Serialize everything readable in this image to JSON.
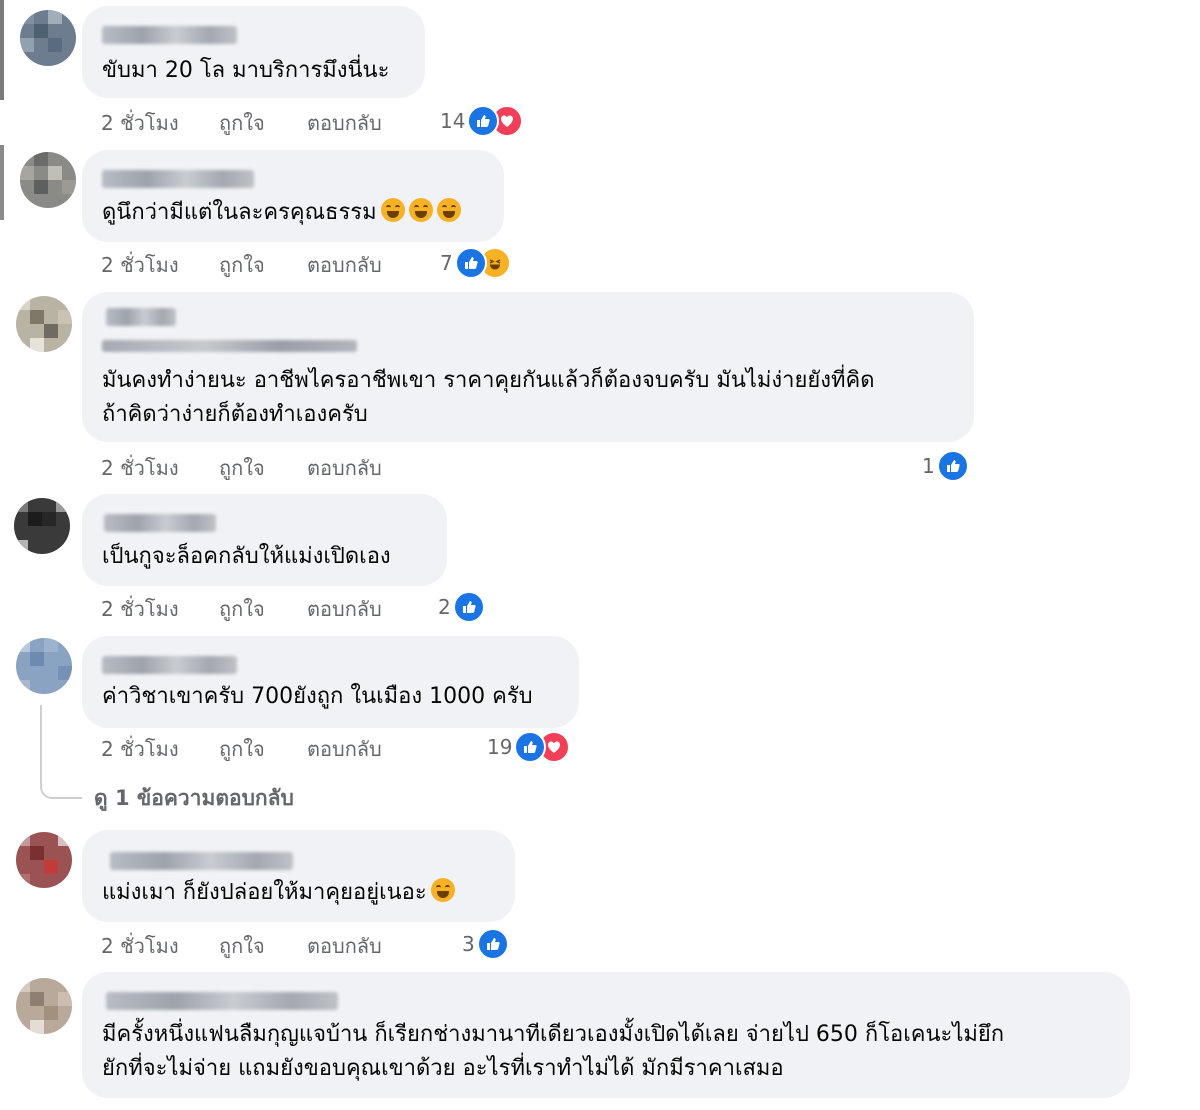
{
  "meta_labels": {
    "time": "2 ชั่วโมง",
    "like": "ถูกใจ",
    "reply": "ตอบกลับ"
  },
  "comments": [
    {
      "text": [
        "ขับมา 20 โล มาบริการมึงนี่นะ"
      ],
      "reaction_count": "14",
      "reactions": [
        "like-icon",
        "love-icon"
      ]
    },
    {
      "text": [
        "ดูนึกว่ามีแต่ในละครคุณธรรม"
      ],
      "emoji": [
        "rofl-emoji",
        "rofl-emoji",
        "rofl-emoji"
      ],
      "reaction_count": "7",
      "reactions": [
        "like-icon",
        "haha-icon"
      ]
    },
    {
      "text": [
        "มันคงทำง่ายนะ อาชีพไครอาชีพเขา ราคาคุยกันแล้วก็ต้องจบครับ มันไม่ง่ายยังที่คิด",
        "ถ้าคิดว่าง่ายก็ต้องทำเองครับ"
      ],
      "reaction_count": "1",
      "reactions": [
        "like-icon"
      ]
    },
    {
      "text": [
        "เป็นกูจะล็อคกลับให้แม่งเปิดเอง"
      ],
      "reaction_count": "2",
      "reactions": [
        "like-icon"
      ]
    },
    {
      "text": [
        "ค่าวิชาเขาครับ 700ยังถูก ในเมือง 1000 ครับ"
      ],
      "reaction_count": "19",
      "reactions": [
        "like-icon",
        "love-icon"
      ]
    },
    {
      "text": [
        "แม่งเมา ก็ยังปล่อยให้มาคุยอยู่เนอะ"
      ],
      "emoji": [
        "laugh-emoji"
      ],
      "reaction_count": "3",
      "reactions": [
        "like-icon"
      ]
    },
    {
      "text": [
        "มีครั้งหนึ่งแฟนลืมกุญแจบ้าน ก็เรียกช่างมานาทีเดียวเองมั้งเปิดได้เลย จ่ายไป 650 ก็โอเคนะไม่ยึก",
        "ยักที่จะไม่จ่าย แถมยังขอบคุณเขาด้วย อะไรที่เราทำไม่ได้ มักมีราคาเสมอ"
      ]
    }
  ],
  "view_replies": "ดู 1 ข้อความตอบกลับ",
  "colors": {
    "bubble": "#f0f2f5",
    "meta_text": "#65676b",
    "like_blue": "#1b74e4",
    "love_red": "#f33e58",
    "haha_yellow": "#f7b125"
  }
}
